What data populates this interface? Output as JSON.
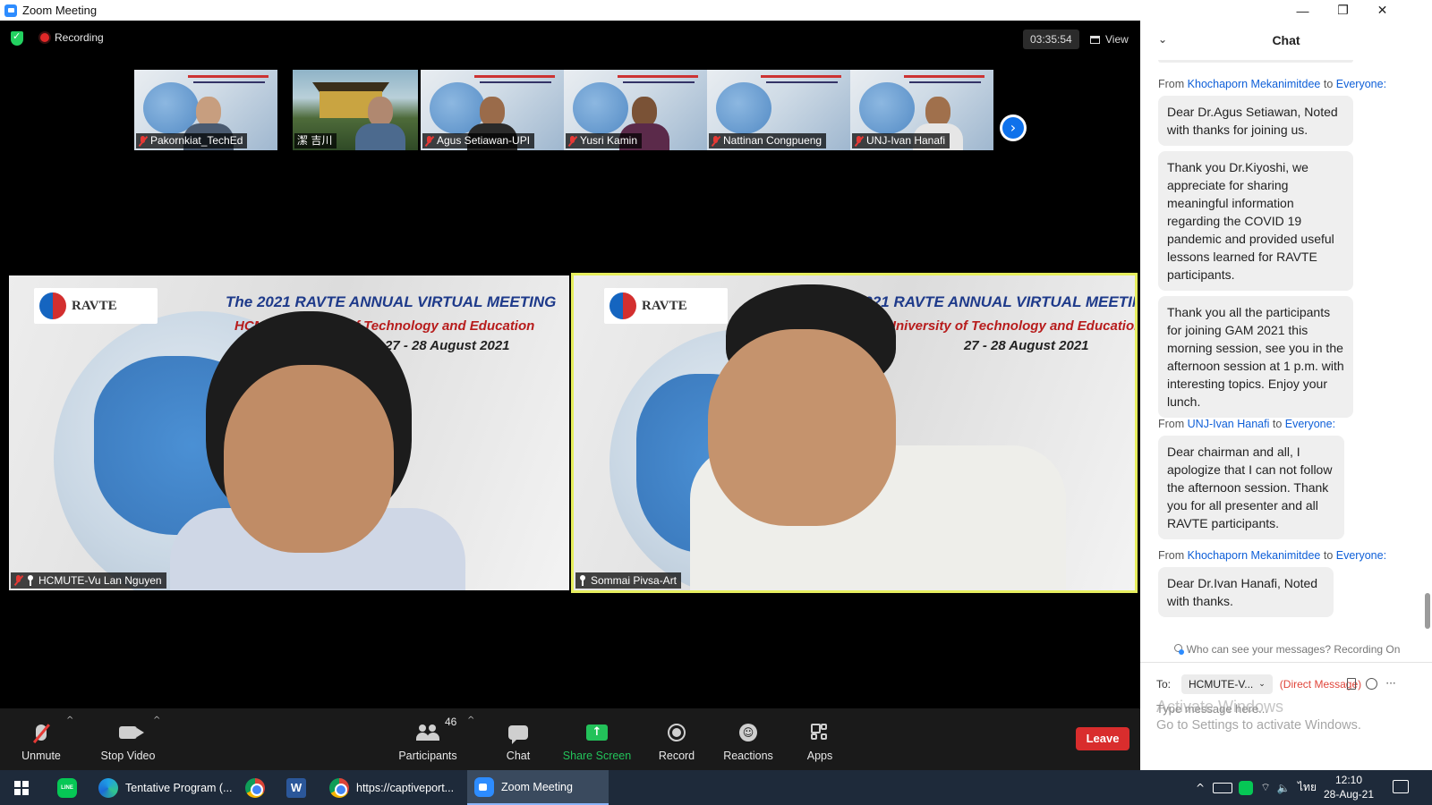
{
  "window": {
    "title": "Zoom Meeting",
    "minimize": "—",
    "restore": "❐",
    "close": "✕"
  },
  "meeting": {
    "recording_label": "Recording",
    "timer": "03:35:54",
    "view_label": "View",
    "thumbnails": [
      {
        "name": "Pakornkiat_TechEd",
        "muted": true
      },
      {
        "name": "潔 吉川",
        "muted": false
      },
      {
        "name": "Agus Setiawan-UPI",
        "muted": true
      },
      {
        "name": "Yusri Kamin",
        "muted": true
      },
      {
        "name": "Nattinan Congpueng",
        "muted": true
      },
      {
        "name": "UNJ-Ivan Hanafi",
        "muted": true
      }
    ],
    "next_arrow": "›",
    "slide": {
      "logo": "RAVTE",
      "title": "The 2021 RAVTE ANNUAL VIRTUAL MEETING",
      "subtitle": "HCMC University of Technology and Education",
      "dates": "27 - 28 August 2021"
    },
    "tiles": [
      {
        "name": "HCMUTE-Vu Lan Nguyen",
        "speaking": false
      },
      {
        "name": "Sommai Pivsa-Art",
        "speaking": true
      }
    ]
  },
  "toolbar": {
    "unmute": "Unmute",
    "stop_video": "Stop Video",
    "participants": "Participants",
    "participants_count": "46",
    "chat": "Chat",
    "share_screen": "Share Screen",
    "record": "Record",
    "reactions": "Reactions",
    "apps": "Apps",
    "leave": "Leave",
    "caret": "^",
    "share_glyph": "↑",
    "reaction_glyph": "☺"
  },
  "chat": {
    "title": "Chat",
    "collapse_glyph": "⌄",
    "groups": [
      {
        "from": "Khochaporn Mekanimitdee",
        "to": "Everyone:",
        "messages": [
          "Dear Dr.Agus Setiawan, Noted with thanks for joining us.",
          "Thank you Dr.Kiyoshi, we appreciate for sharing meaningful information regarding the COVID 19 pandemic and provided useful lessons learned for RAVTE participants.",
          "Thank you all the participants for joining GAM 2021 this morning session, see you in the afternoon session at 1 p.m. with interesting topics. Enjoy your lunch."
        ]
      },
      {
        "from": "UNJ-Ivan Hanafi",
        "to": "Everyone:",
        "messages": [
          "Dear chairman and all, I apologize that I can not follow the afternoon session. Thank you for all presenter and all RAVTE participants."
        ]
      },
      {
        "from": "Khochaporn Mekanimitdee",
        "to": "Everyone:",
        "messages": [
          "Dear Dr.Ivan Hanafi, Noted with thanks."
        ]
      }
    ],
    "from_word": "From",
    "to_word": "to",
    "who_can_see": "Who can see your messages? Recording On",
    "to_label": "To:",
    "recipient": "HCMUTE-V...",
    "direct_message": "(Direct Message)",
    "more_glyph": "···",
    "placeholder": "Type message here..."
  },
  "watermark": {
    "line1": "Activate Windows",
    "line2": "Go to Settings to activate Windows."
  },
  "taskbar": {
    "items": [
      {
        "app": "line-icon",
        "label": ""
      },
      {
        "app": "edge-icon",
        "label": "Tentative Program (..."
      },
      {
        "app": "chrome-icon",
        "label": ""
      },
      {
        "app": "word-icon",
        "label": ""
      },
      {
        "app": "chrome-icon",
        "label": "https://captiveport..."
      },
      {
        "app": "zoom-icon",
        "label": "Zoom Meeting"
      }
    ],
    "line_text": "LINE",
    "word_letter": "W",
    "tray_language": "ไทย",
    "time": "12:10",
    "date": "28-Aug-21"
  }
}
